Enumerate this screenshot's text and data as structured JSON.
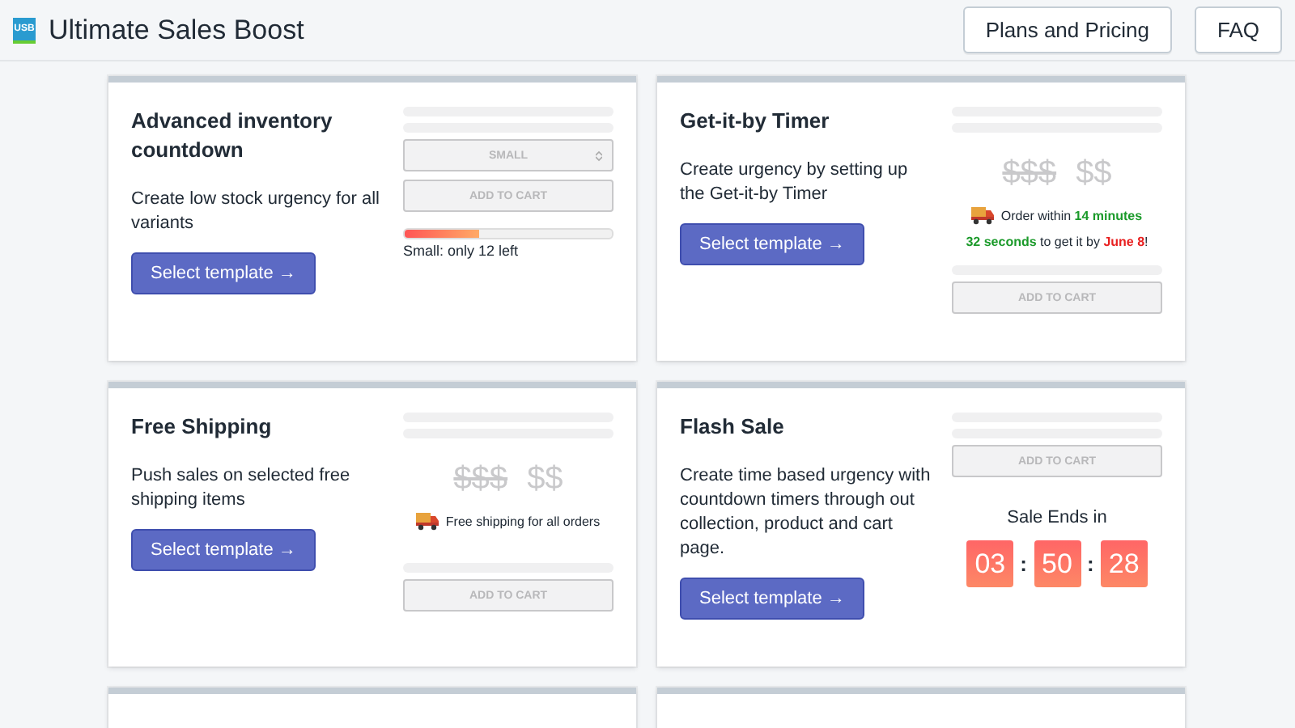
{
  "header": {
    "logo_text": "USB",
    "title": "Ultimate Sales Boost",
    "buttons": [
      "Plans and Pricing",
      "FAQ"
    ]
  },
  "cards": [
    {
      "kind": "inventory",
      "title": "Advanced inventory countdown",
      "description": "Create low stock urgency for all variants",
      "button": "Select template →",
      "preview": {
        "variant": "SMALL",
        "cart": "ADD TO CART",
        "level": 0.36,
        "stock_text": "Small: only 12 left"
      }
    },
    {
      "kind": "timer",
      "title": "Get-it-by Timer",
      "description": "Create urgency by setting up the Get-it-by Timer",
      "button": "Select template →",
      "preview": {
        "old_price": "$$$",
        "price": "$$",
        "order_text": "Order within",
        "order_time": "14 minutes",
        "seconds": "32 seconds",
        "get_text": "to get it by",
        "date": "June 8",
        "end": "!",
        "cart": "ADD TO CART"
      }
    },
    {
      "kind": "shipping",
      "title": "Free Shipping",
      "description": "Push sales on selected free shipping items",
      "button": "Select template →",
      "preview": {
        "old_price": "$$$",
        "price": "$$",
        "shipping_text": "Free shipping for all orders",
        "cart": "ADD TO CART"
      }
    },
    {
      "kind": "flash",
      "title": "Flash Sale",
      "description": "Create time based urgency with countdown timers through out collection, product and cart page.",
      "button": "Select template →",
      "preview": {
        "cart": "ADD TO CART",
        "label": "Sale Ends in",
        "digits": [
          "03",
          "50",
          "28"
        ],
        "separator": ":"
      }
    },
    {
      "kind": "partial"
    },
    {
      "kind": "partial"
    }
  ]
}
